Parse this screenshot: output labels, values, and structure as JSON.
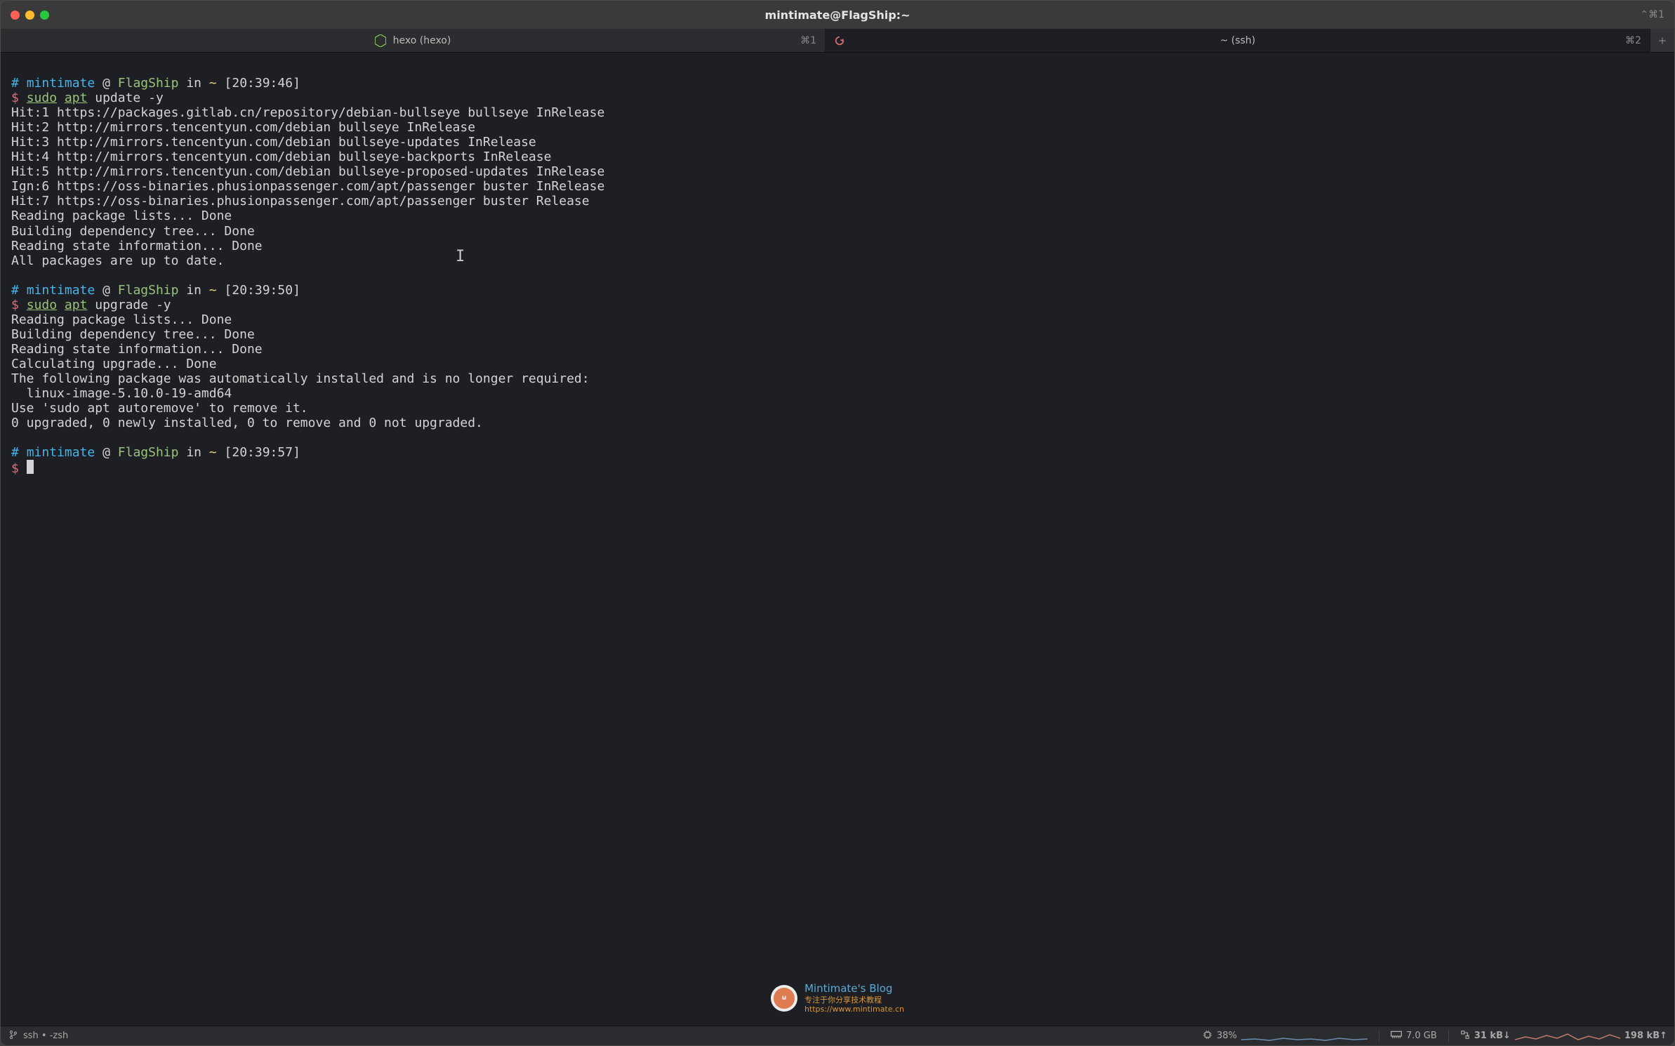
{
  "window": {
    "title": "mintimate@FlagShip:~",
    "keyboard_hint": "⌃⌘1"
  },
  "tabs": [
    {
      "label": "hexo (hexo)",
      "shortcut": "⌘1",
      "icon": "node"
    },
    {
      "label": "~ (ssh)",
      "shortcut": "⌘2",
      "icon": "sync"
    }
  ],
  "prompts": [
    {
      "user": "mintimate",
      "host": "FlagShip",
      "path": "~",
      "time": "[20:39:46]",
      "dollar": "$",
      "cmd": "sudo",
      "sub": "apt",
      "args": "update -y"
    },
    {
      "user": "mintimate",
      "host": "FlagShip",
      "path": "~",
      "time": "[20:39:50]",
      "dollar": "$",
      "cmd": "sudo",
      "sub": "apt",
      "args": "upgrade -y"
    },
    {
      "user": "mintimate",
      "host": "FlagShip",
      "path": "~",
      "time": "[20:39:57]",
      "dollar": "$"
    }
  ],
  "block1": [
    "Hit:1 https://packages.gitlab.cn/repository/debian-bullseye bullseye InRelease",
    "Hit:2 http://mirrors.tencentyun.com/debian bullseye InRelease",
    "Hit:3 http://mirrors.tencentyun.com/debian bullseye-updates InRelease",
    "Hit:4 http://mirrors.tencentyun.com/debian bullseye-backports InRelease",
    "Hit:5 http://mirrors.tencentyun.com/debian bullseye-proposed-updates InRelease",
    "Ign:6 https://oss-binaries.phusionpassenger.com/apt/passenger buster InRelease",
    "Hit:7 https://oss-binaries.phusionpassenger.com/apt/passenger buster Release",
    "Reading package lists... Done",
    "Building dependency tree... Done",
    "Reading state information... Done",
    "All packages are up to date."
  ],
  "block2": [
    "Reading package lists... Done",
    "Building dependency tree... Done",
    "Reading state information... Done",
    "Calculating upgrade... Done",
    "The following package was automatically installed and is no longer required:",
    "  linux-image-5.10.0-19-amd64",
    "Use 'sudo apt autoremove' to remove it.",
    "0 upgraded, 0 newly installed, 0 to remove and 0 not upgraded."
  ],
  "status": {
    "process": "ssh • -zsh",
    "cpu": "38%",
    "mem": "7.0 GB",
    "net_down": "31 kB↓",
    "net_up": "198 kB↑"
  },
  "watermark": {
    "title": "Mintimate's Blog",
    "sub1": "专注于你分享技术教程",
    "sub2": "https://www.mintimate.cn"
  }
}
